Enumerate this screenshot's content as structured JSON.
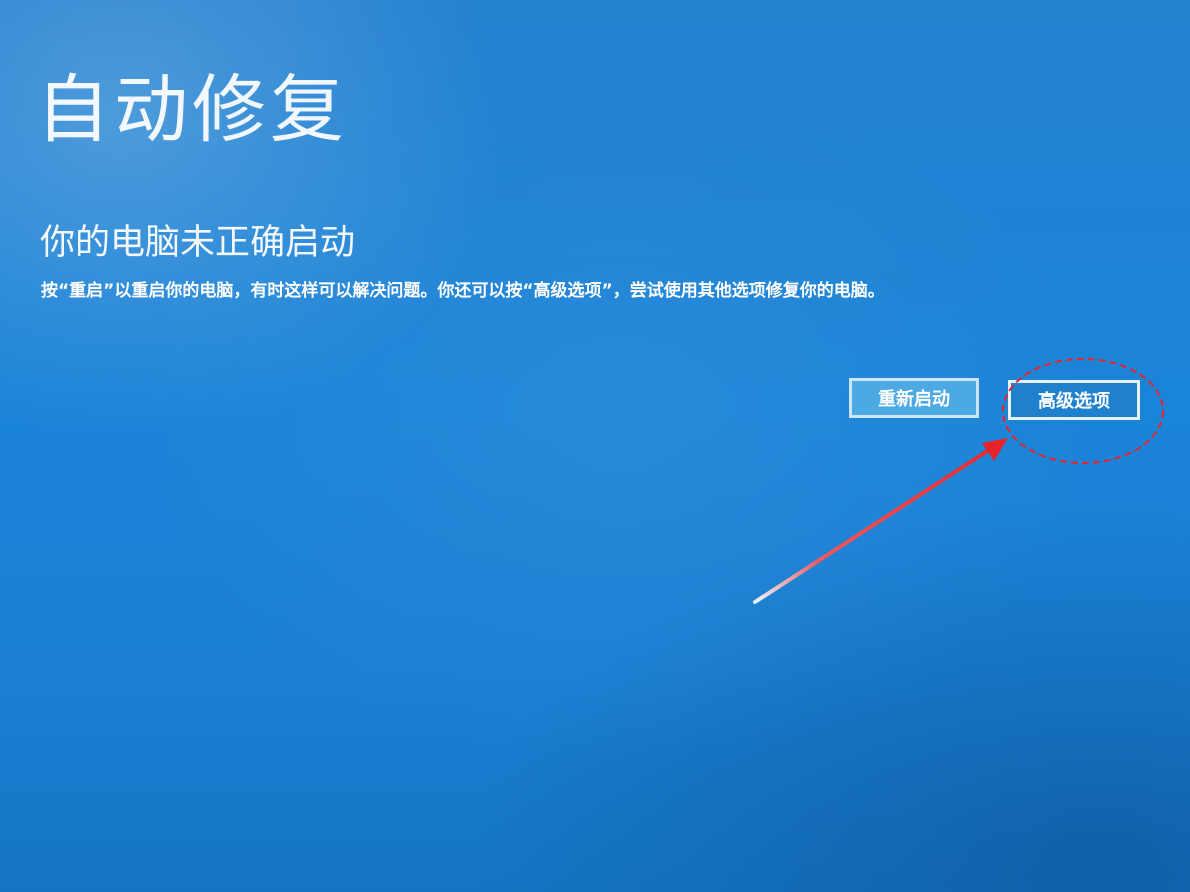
{
  "recovery": {
    "title": "自动修复",
    "subtitle": "你的电脑未正确启动",
    "description": "按“重启”以重启你的电脑，有时这样可以解决问题。你还可以按“高级选项”，尝试使用其他选项修复你的电脑。"
  },
  "actions": {
    "restart_label": "重新启动",
    "advanced_label": "高级选项"
  },
  "colors": {
    "background": "#1a7fd3",
    "annotation": "#e8242b"
  }
}
